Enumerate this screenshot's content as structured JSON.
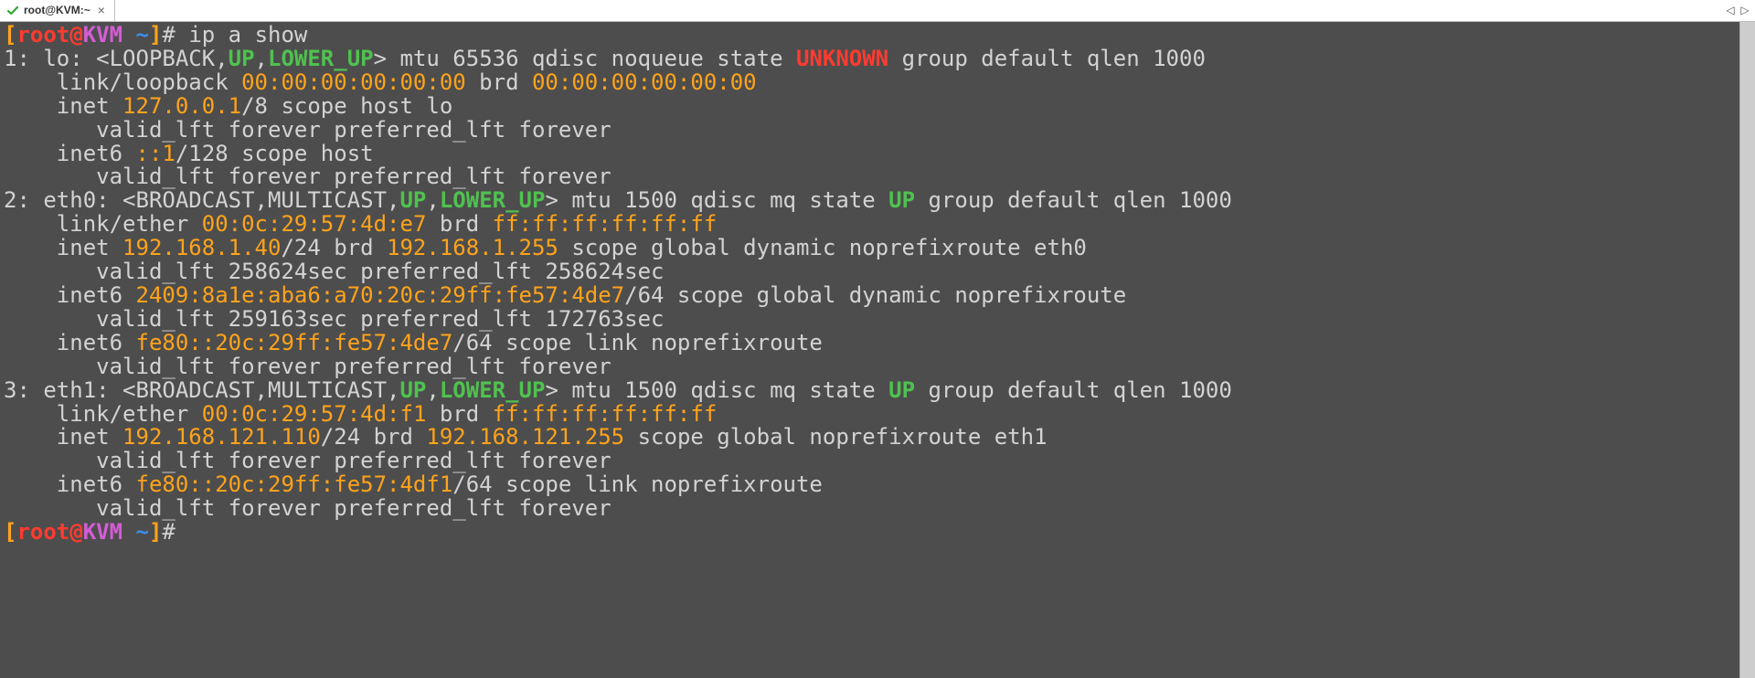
{
  "tab": {
    "title": "root@KVM:~",
    "close_glyph": "×"
  },
  "tabbar_arrows": {
    "left": "◁",
    "right": "▷"
  },
  "prompt": {
    "open": "[",
    "user": "root",
    "at": "@",
    "host": "KVM",
    "space": " ",
    "tilde": "~",
    "close": "]",
    "hash": "#"
  },
  "command": "ip a show",
  "lines": [
    [
      {
        "c": "gray",
        "t": "1: lo: <LOOPBACK,"
      },
      {
        "c": "green",
        "t": "UP"
      },
      {
        "c": "gray",
        "t": ","
      },
      {
        "c": "green",
        "t": "LOWER_UP"
      },
      {
        "c": "gray",
        "t": "> mtu 65536 qdisc noqueue state "
      },
      {
        "c": "redb",
        "t": "UNKNOWN"
      },
      {
        "c": "gray",
        "t": " group default qlen 1000"
      }
    ],
    [
      {
        "c": "gray",
        "t": "    link/loopback "
      },
      {
        "c": "orange",
        "t": "00:00:00:00:00:00"
      },
      {
        "c": "gray",
        "t": " brd "
      },
      {
        "c": "orange",
        "t": "00:00:00:00:00:00"
      }
    ],
    [
      {
        "c": "gray",
        "t": "    inet "
      },
      {
        "c": "orange",
        "t": "127.0.0.1"
      },
      {
        "c": "gray",
        "t": "/8 scope host lo"
      }
    ],
    [
      {
        "c": "gray",
        "t": "       valid_lft forever preferred_lft forever"
      }
    ],
    [
      {
        "c": "gray",
        "t": "    inet6 "
      },
      {
        "c": "orange",
        "t": "::1"
      },
      {
        "c": "gray",
        "t": "/128 scope host"
      }
    ],
    [
      {
        "c": "gray",
        "t": "       valid_lft forever preferred_lft forever"
      }
    ],
    [
      {
        "c": "gray",
        "t": "2: eth0: <BROADCAST,MULTICAST,"
      },
      {
        "c": "green",
        "t": "UP"
      },
      {
        "c": "gray",
        "t": ","
      },
      {
        "c": "green",
        "t": "LOWER_UP"
      },
      {
        "c": "gray",
        "t": "> mtu 1500 qdisc mq state "
      },
      {
        "c": "green",
        "t": "UP"
      },
      {
        "c": "gray",
        "t": " group default qlen 1000"
      }
    ],
    [
      {
        "c": "gray",
        "t": "    link/ether "
      },
      {
        "c": "orange",
        "t": "00:0c:29:57:4d:e7"
      },
      {
        "c": "gray",
        "t": " brd "
      },
      {
        "c": "orange",
        "t": "ff:ff:ff:ff:ff:ff"
      }
    ],
    [
      {
        "c": "gray",
        "t": "    inet "
      },
      {
        "c": "orange",
        "t": "192.168.1.40"
      },
      {
        "c": "gray",
        "t": "/24 brd "
      },
      {
        "c": "orange",
        "t": "192.168.1.255"
      },
      {
        "c": "gray",
        "t": " scope global dynamic noprefixroute eth0"
      }
    ],
    [
      {
        "c": "gray",
        "t": "       valid_lft 258624sec preferred_lft 258624sec"
      }
    ],
    [
      {
        "c": "gray",
        "t": "    inet6 "
      },
      {
        "c": "orange",
        "t": "2409:8a1e:aba6:a70:20c:29ff:fe57:4de7"
      },
      {
        "c": "gray",
        "t": "/64 scope global dynamic noprefixroute"
      }
    ],
    [
      {
        "c": "gray",
        "t": "       valid_lft 259163sec preferred_lft 172763sec"
      }
    ],
    [
      {
        "c": "gray",
        "t": "    inet6 "
      },
      {
        "c": "orange",
        "t": "fe80::20c:29ff:fe57:4de7"
      },
      {
        "c": "gray",
        "t": "/64 scope link noprefixroute"
      }
    ],
    [
      {
        "c": "gray",
        "t": "       valid_lft forever preferred_lft forever"
      }
    ],
    [
      {
        "c": "gray",
        "t": "3: eth1: <BROADCAST,MULTICAST,"
      },
      {
        "c": "green",
        "t": "UP"
      },
      {
        "c": "gray",
        "t": ","
      },
      {
        "c": "green",
        "t": "LOWER_UP"
      },
      {
        "c": "gray",
        "t": "> mtu 1500 qdisc mq state "
      },
      {
        "c": "green",
        "t": "UP"
      },
      {
        "c": "gray",
        "t": " group default qlen 1000"
      }
    ],
    [
      {
        "c": "gray",
        "t": "    link/ether "
      },
      {
        "c": "orange",
        "t": "00:0c:29:57:4d:f1"
      },
      {
        "c": "gray",
        "t": " brd "
      },
      {
        "c": "orange",
        "t": "ff:ff:ff:ff:ff:ff"
      }
    ],
    [
      {
        "c": "gray",
        "t": "    inet "
      },
      {
        "c": "orange",
        "t": "192.168.121.110"
      },
      {
        "c": "gray",
        "t": "/24 brd "
      },
      {
        "c": "orange",
        "t": "192.168.121.255"
      },
      {
        "c": "gray",
        "t": " scope global noprefixroute eth1"
      }
    ],
    [
      {
        "c": "gray",
        "t": "       valid_lft forever preferred_lft forever"
      }
    ],
    [
      {
        "c": "gray",
        "t": "    inet6 "
      },
      {
        "c": "orange",
        "t": "fe80::20c:29ff:fe57:4df1"
      },
      {
        "c": "gray",
        "t": "/64 scope link noprefixroute"
      }
    ],
    [
      {
        "c": "gray",
        "t": "       valid_lft forever preferred_lft forever"
      }
    ]
  ]
}
